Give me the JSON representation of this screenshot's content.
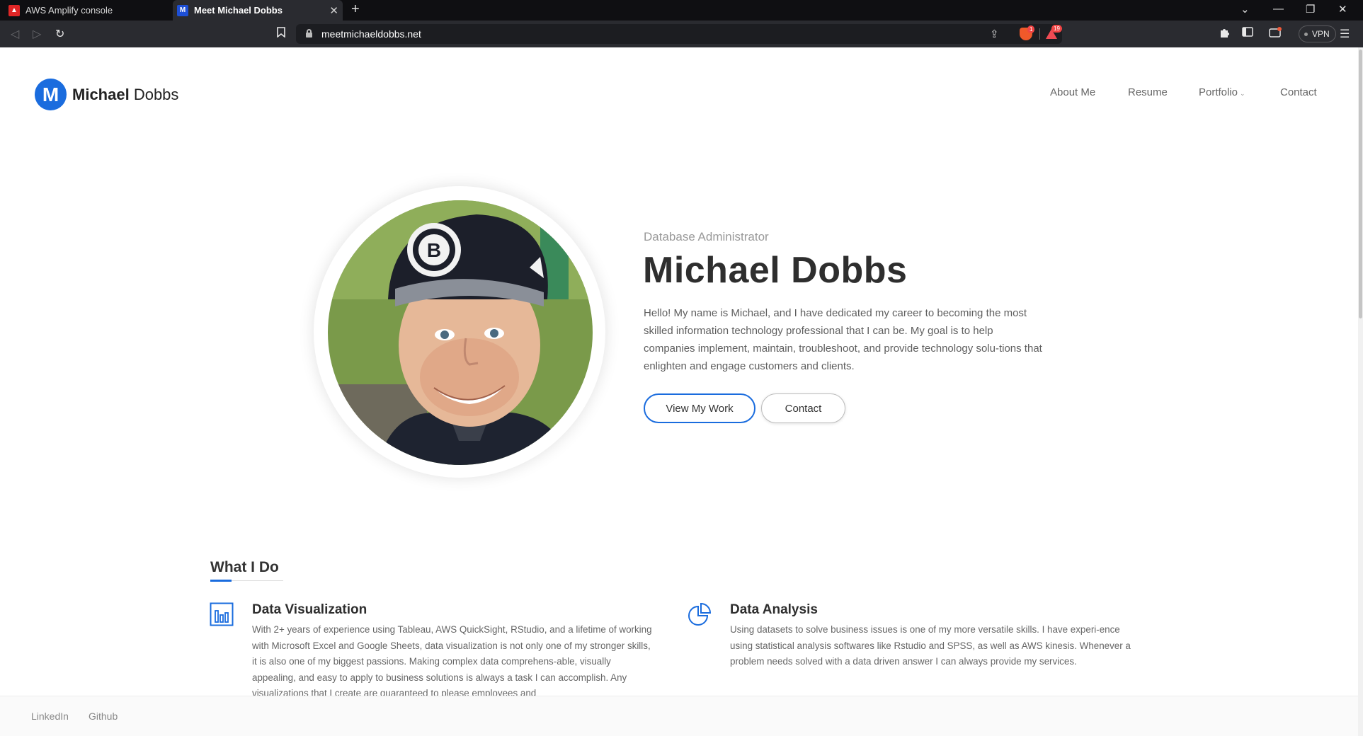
{
  "browser": {
    "tabs": [
      {
        "title": "AWS Amplify console",
        "active": false
      },
      {
        "title": "Meet Michael Dobbs",
        "active": true
      }
    ],
    "url": "meetmichaeldobbs.net",
    "vpn_label": "VPN",
    "brave_badge": "1",
    "rewards_badge": "19"
  },
  "site": {
    "logo_letter": "M",
    "brand_first": "Michael",
    "brand_last": "Dobbs",
    "nav": [
      "About Me",
      "Resume",
      "Portfolio",
      "Contact"
    ]
  },
  "hero": {
    "subtitle": "Database Administrator",
    "name": "Michael Dobbs",
    "intro": "Hello! My name is Michael, and I have dedicated my career to becoming the most skilled information technology professional that I can be. My goal is to help companies implement, maintain, troubleshoot, and provide technology solu-tions that enlighten and engage customers and clients.",
    "primary_button": "View My Work",
    "secondary_button": "Contact"
  },
  "services": {
    "title": "What I Do",
    "items": [
      {
        "icon": "bar-chart-icon",
        "title": "Data Visualization",
        "text": "With 2+ years of experience using Tableau, AWS QuickSight, RStudio, and a lifetime of working with Microsoft Excel and Google Sheets, data visualization is not only one of my stronger skills, it is also one of my biggest passions. Making complex data comprehens-able, visually appealing, and easy to apply to business solutions is always a task I can accomplish. Any visualizations that I create are guaranteed to please employees and"
      },
      {
        "icon": "pie-chart-icon",
        "title": "Data Analysis",
        "text": "Using datasets to solve business issues is one of my more versatile skills. I have experi-ence using statistical analysis softwares like Rstudio and SPSS, as well as AWS kinesis. Whenever a problem needs solved with a data driven answer I can always provide my services."
      }
    ]
  },
  "footer": {
    "links": [
      "LinkedIn",
      "Github"
    ]
  },
  "colors": {
    "accent": "#1a6cde",
    "chrome_dark": "#0f0f12",
    "toolbar": "#2a2b30"
  }
}
